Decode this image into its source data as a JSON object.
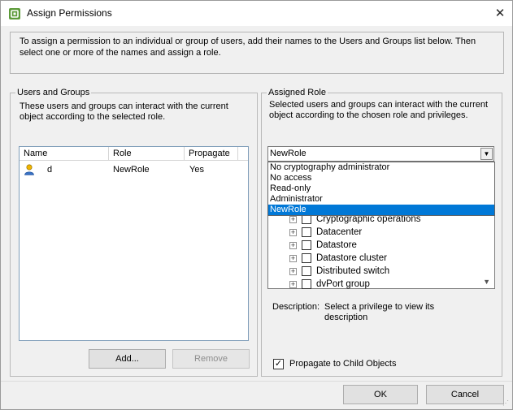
{
  "window": {
    "title": "Assign Permissions",
    "close_glyph": "✕"
  },
  "intro_text": "To assign a permission to an individual or group of users, add their names to the Users and Groups list below. Then select one or more of the names and assign a role.",
  "users_groups": {
    "title": "Users and Groups",
    "description": "These users and groups can interact with the current object according to the selected role.",
    "columns": [
      "Name",
      "Role",
      "Propagate"
    ],
    "rows": [
      {
        "name": "d",
        "role": "NewRole",
        "propagate": "Yes",
        "icon": "user-icon"
      }
    ],
    "add_label": "Add...",
    "remove_label": "Remove"
  },
  "assigned_role": {
    "title": "Assigned Role",
    "description": "Selected users and groups can interact with the current object according to the chosen role and privileges.",
    "selected_role": "NewRole",
    "role_options": [
      "No cryptography administrator",
      "No access",
      "Read-only",
      "Administrator",
      "NewRole"
    ],
    "privileges": [
      "Cryptographic operations",
      "Datacenter",
      "Datastore",
      "Datastore cluster",
      "Distributed switch",
      "dvPort group"
    ],
    "description_label": "Description:",
    "description_value": "Select a privilege to view its description",
    "propagate_label": "Propagate to Child Objects",
    "propagate_checked": true
  },
  "footer": {
    "ok_label": "OK",
    "cancel_label": "Cancel"
  },
  "colors": {
    "selection": "#0078d7",
    "window_bg": "#f0f0f0",
    "icon_green": "#6aa84f"
  }
}
